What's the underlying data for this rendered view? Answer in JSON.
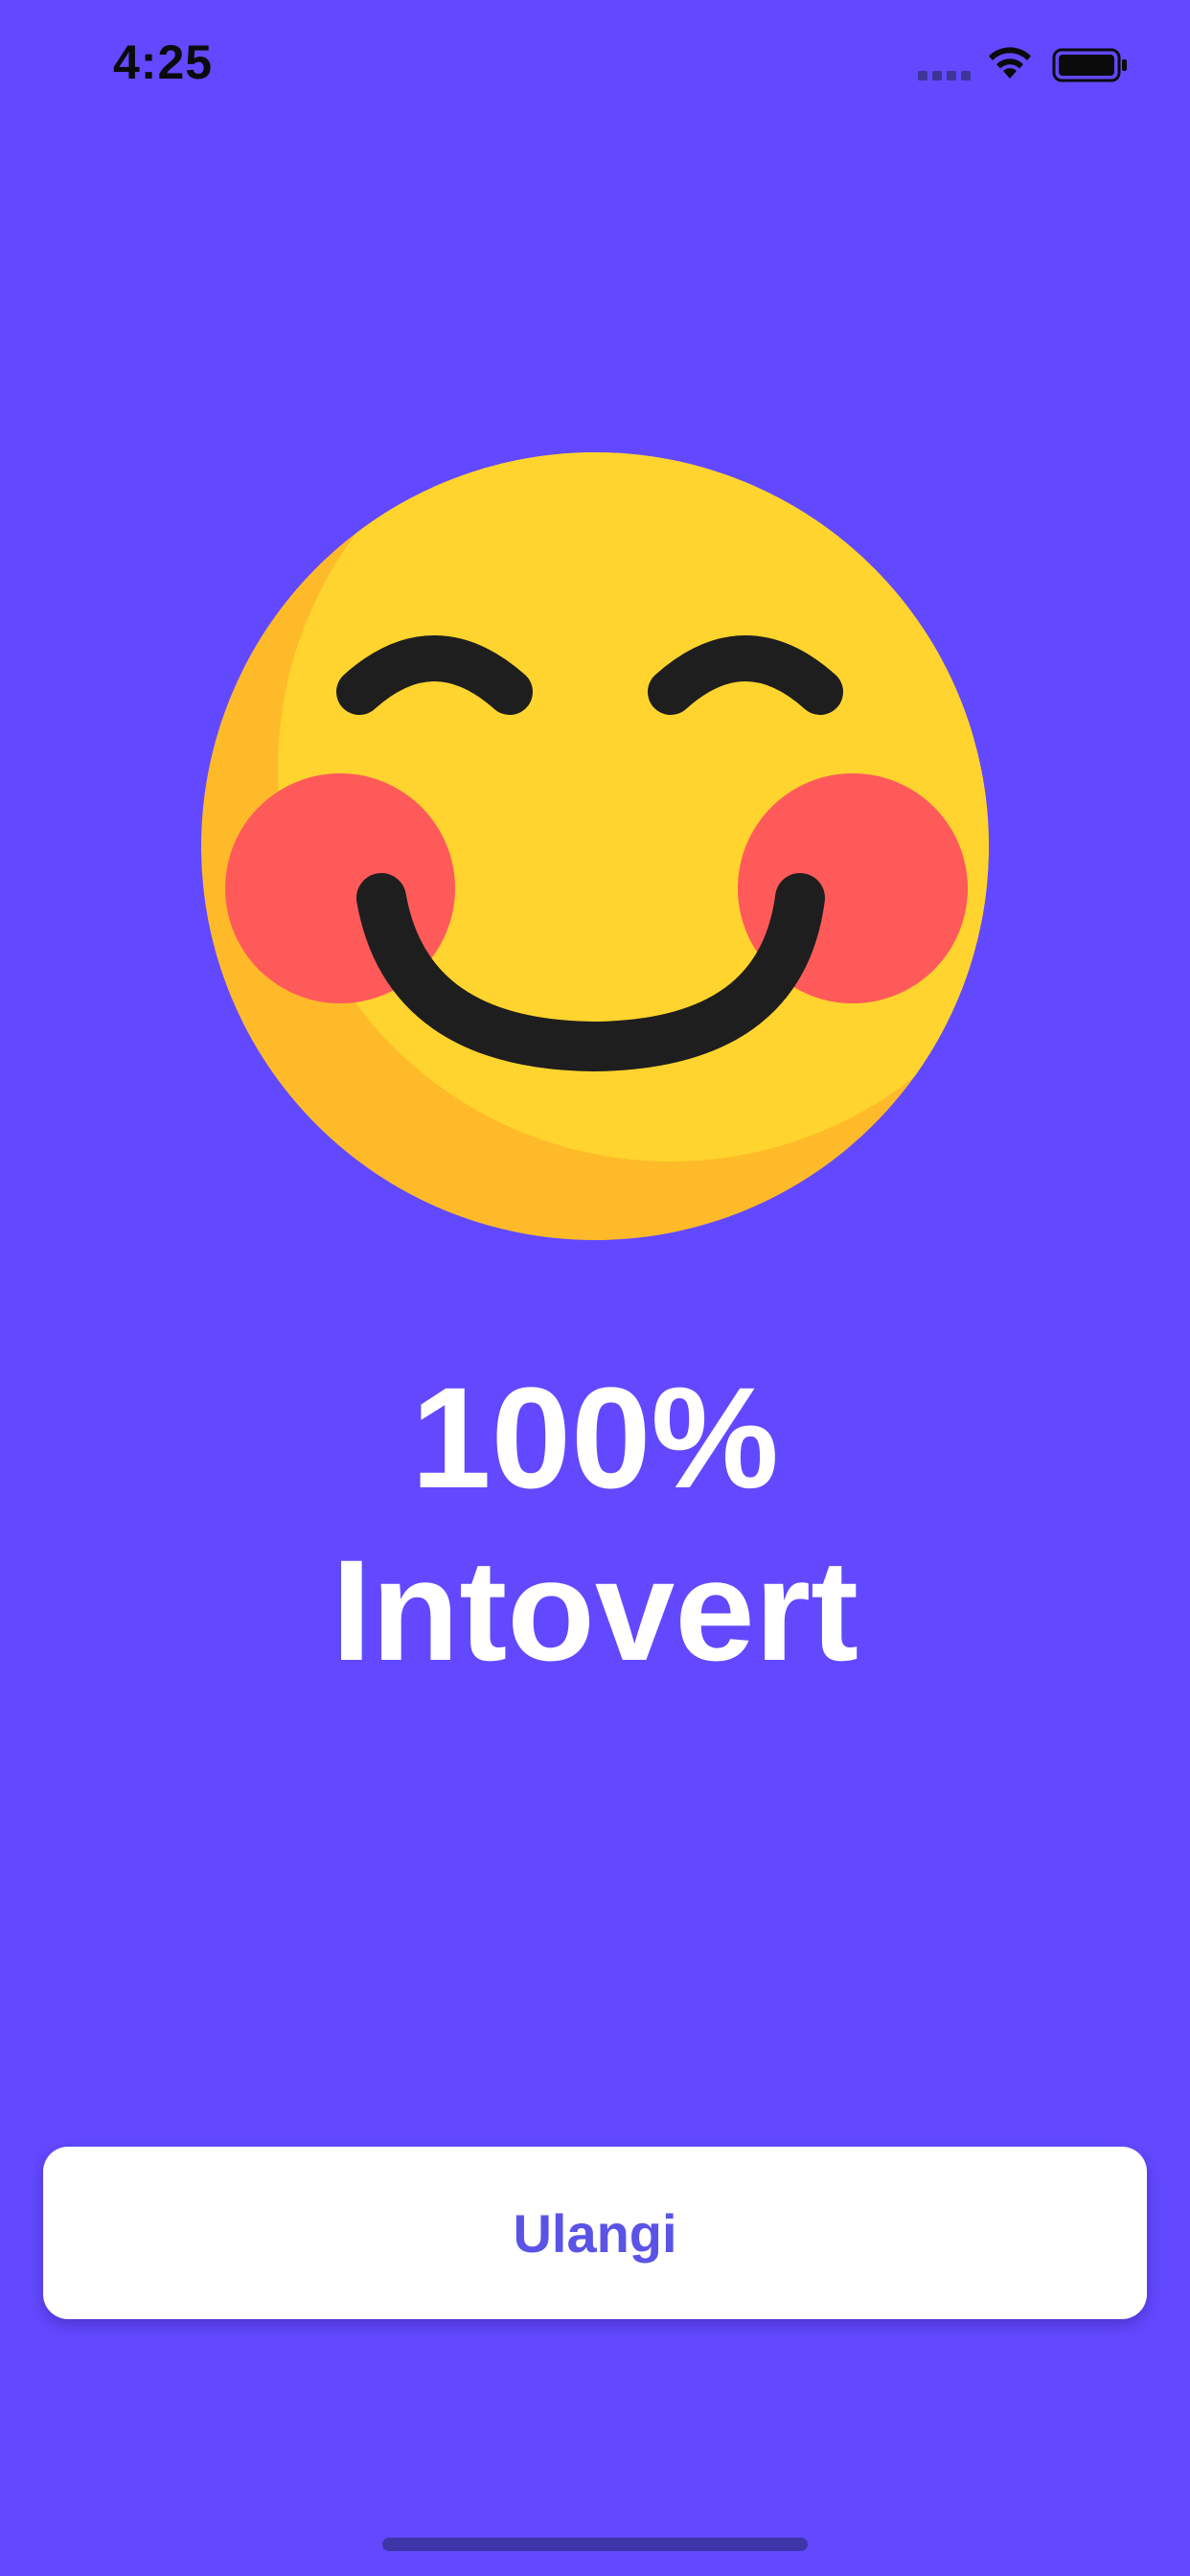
{
  "status_bar": {
    "time": "4:25",
    "icons": [
      "cellular-signal-icon",
      "wifi-icon",
      "battery-icon"
    ]
  },
  "result": {
    "emoji": "smiling-blushing-face-icon",
    "percentage": "100%",
    "label": "Intovert"
  },
  "actions": {
    "retry_label": "Ulangi"
  },
  "colors": {
    "background": "#6249FF",
    "button_background": "#FFFFFF",
    "button_text": "#5B53E6",
    "emoji_face": "#FFD42E",
    "emoji_shade": "#FFBA2A",
    "emoji_cheeks": "#FF5A5A",
    "emoji_features": "#1E1E1E"
  }
}
